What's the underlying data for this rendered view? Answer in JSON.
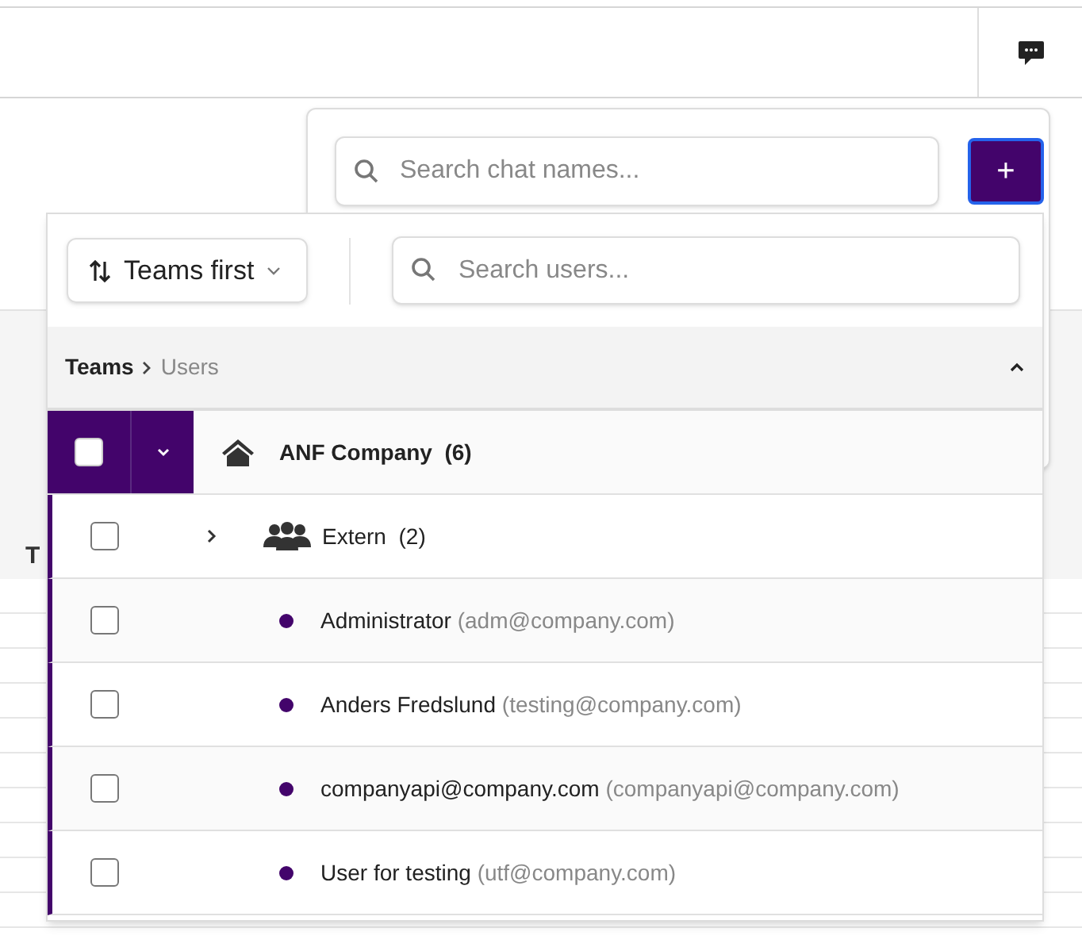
{
  "background": {
    "text_fragment": "T"
  },
  "chat_panel": {
    "search": {
      "placeholder": "Search chat names..."
    },
    "add_button": "+"
  },
  "user_picker": {
    "sort": {
      "label": "Teams first"
    },
    "search": {
      "placeholder": "Search users..."
    },
    "breadcrumb": {
      "items": [
        "Teams",
        "Users"
      ]
    },
    "tree": [
      {
        "kind": "team",
        "name": "ANF Company",
        "count": "(6)",
        "checked": false,
        "expanded": true,
        "children": [
          {
            "kind": "team",
            "name": "Extern",
            "count": "(2)",
            "checked": false,
            "expanded": false
          },
          {
            "kind": "user",
            "name": "Administrator",
            "email": "(adm@company.com)",
            "checked": false
          },
          {
            "kind": "user",
            "name": "Anders Fredslund",
            "email": "(testing@company.com)",
            "checked": false
          },
          {
            "kind": "user",
            "name": "companyapi@company.com",
            "email": "(companyapi@company.com)",
            "checked": false
          },
          {
            "kind": "user",
            "name": "User for testing",
            "email": "(utf@company.com)",
            "checked": false
          }
        ]
      }
    ]
  }
}
